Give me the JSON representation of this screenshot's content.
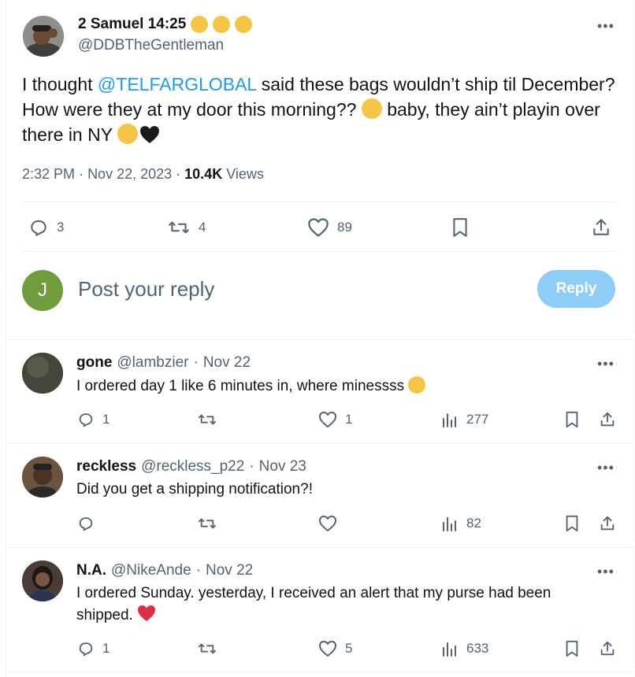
{
  "tweet": {
    "author_name": "2 Samuel 14:25",
    "author_handle": "@DDBTheGentleman",
    "text_before_mention": "I thought ",
    "mention": "@TELFARGLOBAL",
    "text_line1_rest": " said these bags wouldn’t ship til December?",
    "text_line2": "How were they at my door this morning?? ",
    "text_line2_rest": " baby, they ain’t playin over",
    "text_line3": "there in NY ",
    "time": "2:32 PM",
    "date": "Nov 22, 2023",
    "views_count": "10.4K",
    "views_label": "Views",
    "replies": "3",
    "retweets": "4",
    "likes": "89"
  },
  "compose": {
    "avatar_initial": "J",
    "placeholder": "Post your reply",
    "button": "Reply"
  },
  "replies": [
    {
      "name": "gone",
      "handle": "@lambzier",
      "date": "Nov 22",
      "text": "I ordered day 1 like 6 minutes in, where minessss ",
      "replies": "1",
      "retweets": "",
      "likes": "1",
      "views": "277"
    },
    {
      "name": "reckless",
      "handle": "@reckless_p22",
      "date": "Nov 23",
      "text": "Did you get a shipping notification?!",
      "replies": "",
      "retweets": "",
      "likes": "",
      "views": "82"
    },
    {
      "name": "N.A.",
      "handle": "@NikeAnde",
      "date": "Nov 22",
      "text_line1": "I ordered Sunday.  yesterday, I received an alert that my purse had been",
      "text_line2": "shipped. ",
      "replies": "1",
      "retweets": "",
      "likes": "5",
      "views": "633"
    }
  ],
  "colors": {
    "accent": "#1d9bf0",
    "reply_button": "#8ecdf7",
    "compose_avatar": "#6f9d3b",
    "muted": "#536471"
  }
}
